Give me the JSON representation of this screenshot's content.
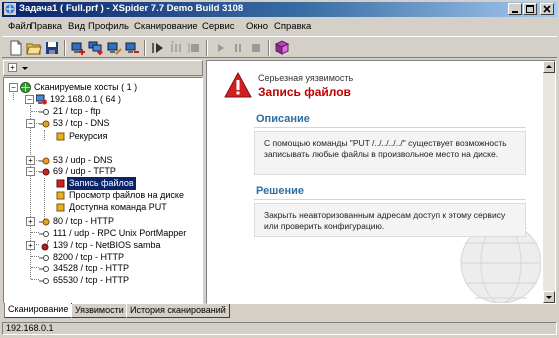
{
  "window": {
    "title": "Задача1 ( Full.prf ) - XSpider 7.7 Demo Build 3108"
  },
  "menu": [
    "Файл",
    "Правка",
    "Вид",
    "Профиль",
    "Сканирование",
    "Сервис",
    "Окно",
    "Справка"
  ],
  "toolbar": {
    "icons": [
      "new-document-icon",
      "open-folder-icon",
      "save-icon",
      "add-host-icon",
      "add-hosts-icon",
      "edit-host-icon",
      "delete-host-icon",
      "start-scan-icon",
      "start-selected-icon",
      "stop-selected-icon",
      "pause-icon",
      "resume-icon",
      "stop-icon",
      "generate-report-icon"
    ]
  },
  "left_toolbar": {
    "expand_label": "+",
    "dropdown_icon": "chevron-down-icon"
  },
  "tree": {
    "root": "Сканируемые хосты ( 1 )",
    "host": "192.168.0.1 ( 64 )",
    "nodes": [
      "21 / tcp - ftp",
      "53 / tcp - DNS",
      "Рекурсия",
      "53 / udp - DNS",
      "69 / udp - TFTP",
      "Запись файлов",
      "Просмотр файлов на диске",
      "Доступна команда PUT",
      "80 / tcp - HTTP",
      "111 / udp - RPC  Unix PortMapper",
      "139 / tcp - NetBIOS samba",
      "8200 / tcp - HTTP",
      "34528 / tcp - HTTP",
      "65530 / tcp - HTTP"
    ]
  },
  "detail": {
    "severity": "Серьезная уязвимость",
    "title": "Запись файлов",
    "description_heading": "Описание",
    "description_text": "С помощью команды \"PUT /../../../../\" существует возможность записывать любые файлы в произвольное место на диске.",
    "solution_heading": "Решение",
    "solution_text": "Закрыть неавторизованным адресам доступ к этому сервису или проверить конфигурацию."
  },
  "tabs": [
    "Сканирование",
    "Уязвимости",
    "История сканирований"
  ],
  "status": {
    "address": "192.168.0.1"
  },
  "colors": {
    "title_gradient_start": "#0a246a",
    "title_gradient_end": "#a6caf0",
    "vuln_title": "#c00000",
    "section_heading": "#2e6e9e",
    "selection": "#0a246a"
  }
}
